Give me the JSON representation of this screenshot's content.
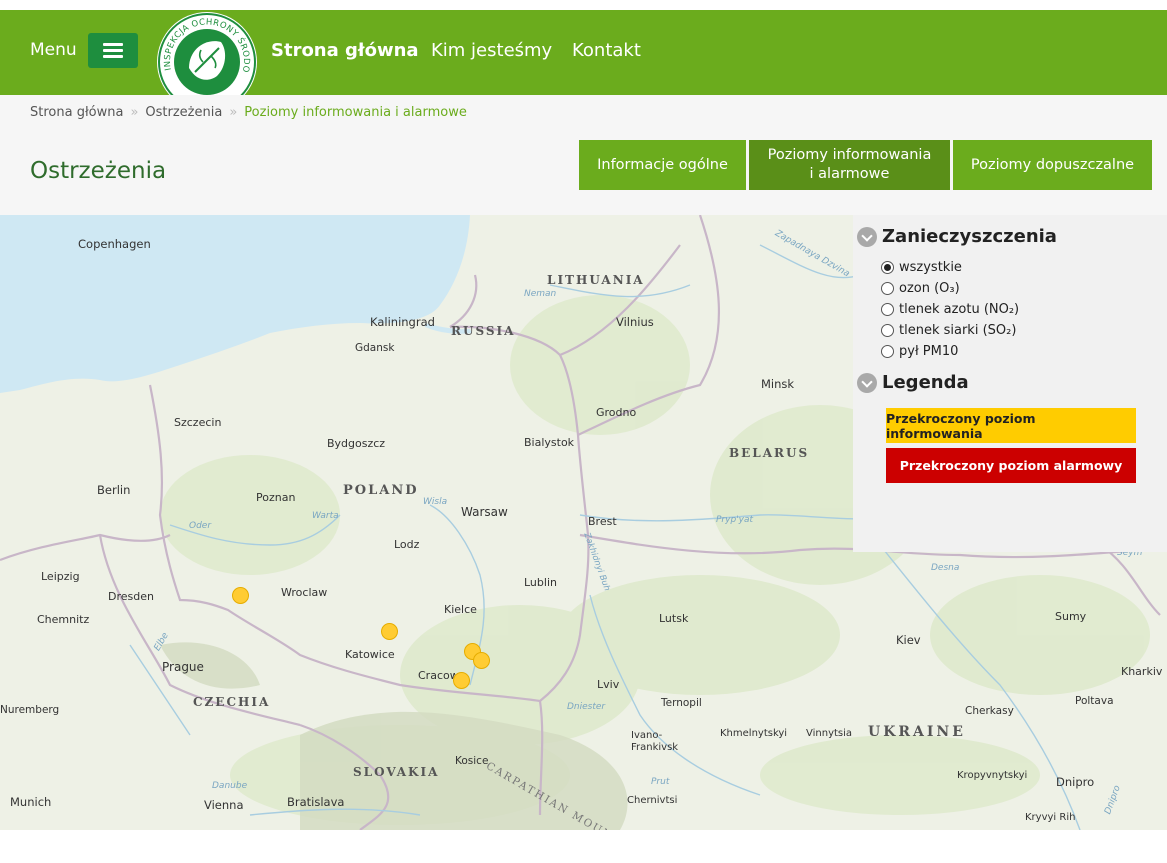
{
  "header": {
    "menu_label": "Menu",
    "logo_text": "INSPEKCJA OCHRONY ŚRODOWISKA",
    "nav": [
      "Strona główna",
      "Kim jesteśmy",
      "Kontakt"
    ]
  },
  "breadcrumb": [
    "Strona główna",
    "Ostrzeżenia",
    "Poziomy informowania i alarmowe"
  ],
  "page_title": "Ostrzeżenia",
  "tabs": [
    {
      "label": "Informacje ogólne",
      "active": false
    },
    {
      "label": "Poziomy informowania\ni alarmowe",
      "active": true
    },
    {
      "label": "Poziomy dopuszczalne",
      "active": false
    }
  ],
  "panel": {
    "pollutants_title": "Zanieczyszczenia",
    "options": [
      "wszystkie",
      "ozon (O₃)",
      "tlenek azotu (NO₂)",
      "tlenek siarki (SO₂)",
      "pył PM10"
    ],
    "selected": "wszystkie",
    "legend_title": "Legenda",
    "legend": [
      {
        "label": "Przekroczony poziom informowania",
        "color": "#ffcc00"
      },
      {
        "label": "Przekroczony poziom alarmowy",
        "color": "#cc0000"
      }
    ]
  },
  "map": {
    "countries": [
      "LITHUANIA",
      "RUSSIA",
      "POLAND",
      "BELARUS",
      "CZECHIA",
      "SLOVAKIA",
      "UKRAINE"
    ],
    "cities": [
      "Copenhagen",
      "Kaliningrad",
      "Vilnius",
      "Gdansk",
      "Minsk",
      "Szczecin",
      "Grodno",
      "Bydgoszcz",
      "Bialystok",
      "Berlin",
      "Poznan",
      "Warsaw",
      "Brest",
      "Lodz",
      "Leipzig",
      "Dresden",
      "Wroclaw",
      "Lublin",
      "Chemnitz",
      "Kielce",
      "Lutsk",
      "Sumy",
      "Kiev",
      "Prague",
      "Katowice",
      "Cracow",
      "Kharkiv",
      "Lviv",
      "Ternopil",
      "Poltava",
      "Cherkasy",
      "Nuremberg",
      "Khmelnytskyi",
      "Vinnytsia",
      "Ivano-Frankivsk",
      "Kosice",
      "Kropyvnytskyi",
      "Dnipro",
      "Munich",
      "Vienna",
      "Bratislava",
      "Chernivtsi",
      "Kryvyi Rih"
    ],
    "rivers": [
      "Neman",
      "Zapadnaya Dzvina",
      "Warta",
      "Wisla",
      "Oder",
      "Pryp'yat",
      "Desna",
      "Elbe",
      "Dniester",
      "Danube",
      "Prut",
      "Zakhidnyi Buh"
    ],
    "other_labels": [
      "CARPATHIAN MOUNTAINS",
      "Seym",
      "Dnipro"
    ],
    "alerts": [
      {
        "level": "information",
        "color": "#ffcc00"
      },
      {
        "level": "information",
        "color": "#ffcc00"
      },
      {
        "level": "information",
        "color": "#ffcc00"
      },
      {
        "level": "information",
        "color": "#ffcc00"
      },
      {
        "level": "information",
        "color": "#ffcc00"
      }
    ]
  }
}
